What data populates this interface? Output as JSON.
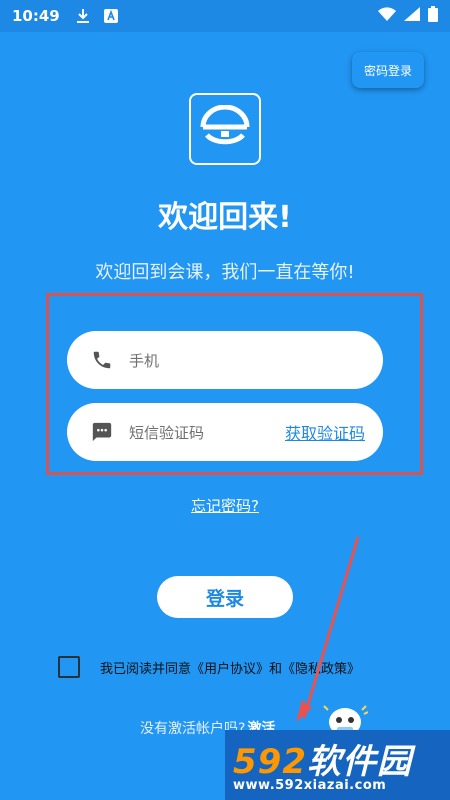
{
  "status_bar": {
    "time": "10:49"
  },
  "header": {
    "password_login_label": "密码登录"
  },
  "main": {
    "title": "欢迎回来!",
    "subtitle": "欢迎回到会课，我们一直在等你!",
    "phone_placeholder": "手机",
    "code_placeholder": "短信验证码",
    "get_code_label": "获取验证码",
    "forgot_password_label": "忘记密码?",
    "login_button_label": "登录",
    "agreement": {
      "prefix": "我已阅读并同意",
      "user_agreement": "《用户协议》",
      "and": "和",
      "privacy_policy": "《隐私政策》"
    },
    "activate": {
      "question": "没有激活帐户吗?",
      "link": "激活"
    }
  },
  "watermark": {
    "number": "592",
    "name": "软件园",
    "url": "www.592xiazai.com"
  },
  "colors": {
    "background": "#2196F3",
    "status_bar": "#1E88E5",
    "accent_link": "#1E88E5",
    "highlight_frame": "#D9534F",
    "annotation_arrow": "#E8534F"
  },
  "icons": [
    "download-icon",
    "text-icon",
    "wifi-icon",
    "signal-icon",
    "battery-icon",
    "phone-icon",
    "message-icon",
    "logo-icon",
    "mascot-icon"
  ]
}
